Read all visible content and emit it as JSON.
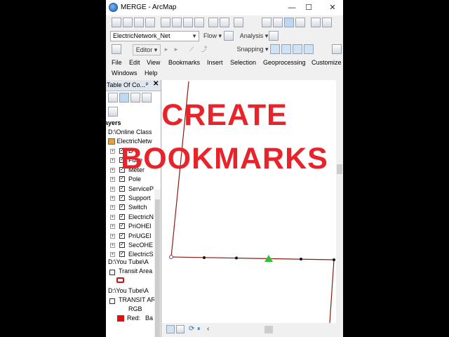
{
  "window": {
    "title": "MERGE - ArcMap",
    "minimize": "—",
    "maximize": "☐",
    "close": "✕"
  },
  "toolbar2": {
    "layer_combo": "ElectricNetwork_Net",
    "flow": "Flow ▾",
    "analysis": "Analysis ▾"
  },
  "toolbar3": {
    "editor": "Editor ▾",
    "snapping": "Snapping ▾"
  },
  "menu": [
    "File",
    "Edit",
    "View",
    "Bookmarks",
    "Insert",
    "Selection",
    "Geoprocessing",
    "Customize",
    "Windows",
    "Help"
  ],
  "toc": {
    "title": "Table Of Co...",
    "pin": "ᵖ",
    "close": "✕",
    "root": "ayers",
    "group1": "D:\\Online Class",
    "network": "ElectricNetw",
    "layers": [
      "D",
      "Fuse",
      "Meter",
      "Pole",
      "ServiceP",
      "Support",
      "Switch",
      "ElectricN",
      "PriOHEl",
      "PriUGEl",
      "SecOHE",
      "ElectricS"
    ],
    "group2": "D:\\You Tube\\A",
    "transit": "Transit Area",
    "group3": "D:\\You Tube\\A",
    "transit_ar": "TRANSIT AR",
    "rgb": "RGB",
    "red": "Red:",
    "band": "Ba"
  },
  "overlay": {
    "line1": "CREATE",
    "line2": "BOOKMARKS"
  },
  "colors": {
    "overlay": "#e8232a",
    "line": "#8b1a10",
    "point_marker": "#2dbf3a"
  }
}
